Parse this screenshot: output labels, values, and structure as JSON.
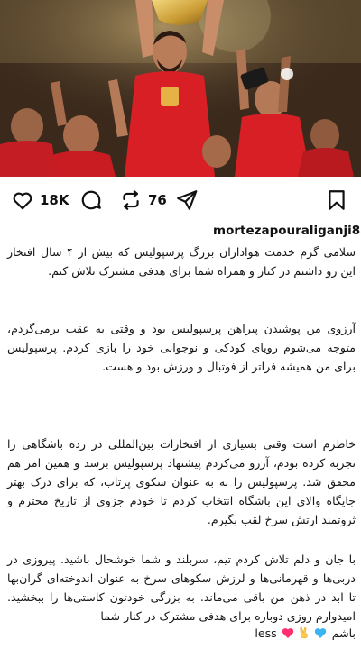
{
  "post": {
    "image": {
      "description_icon": "celebration-photo",
      "colors": {
        "jersey": "#d81f26",
        "trophy": "#d9b24a"
      }
    },
    "actions": {
      "like_icon": "heart-icon",
      "like_count": "18K",
      "comment_icon": "comment-icon",
      "repost_icon": "repost-icon",
      "repost_count": "76",
      "share_icon": "send-icon",
      "save_icon": "bookmark-icon"
    },
    "username": "mortezapouraliganji88 .",
    "caption": {
      "paragraph_1": "سلامی گرم خدمت هواداران بزرگ پرسپولیس که بیش از ۴ سال افتخار این رو داشتم در کنار و همراه شما برای هدفی مشترک تلاش کنم.",
      "paragraph_2": "آرزوی من پوشیدن پیراهن پرسپولیس بود و وقتی به عقب برمی‌گردم، متوجه می‌شوم رویای کودکی و نوجوانی خود را بازی کردم. پرسپولیس برای من همیشه فراتر از فوتبال و ورزش بود و هست.",
      "paragraph_3": "خاطرم است وقتی بسیاری از افتخارات بین‌المللی در رده باشگاهی را تجربه کرده بودم، آرزو می‌کردم پیشنهاد پرسپولیس برسد و همین امر هم محقق شد. پرسپولیس را نه به عنوان سکوی پرتاب، که برای درک بهتر جایگاه والای این باشگاه انتخاب کردم تا خودم جزوی از تاریخ محترم و ثروتمند ارتش سرخ لقب بگیرم.",
      "paragraph_4": "با جان و دلم تلاش کردم تیم، سربلند و شما خوشحال باشید. پیروزی در دربی‌ها و قهرمانی‌ها و لرزش سکوهای سرخ به عنوان اندوخته‌ای گران‌بها تا ابد در ذهن من باقی می‌ماند. به بزرگی خودتون کاستی‌ها را ببخشید. امیدوارم روزی دوباره برای هدفی مشترک در کنار شما",
      "closing_word": "باشم",
      "closing_emojis": [
        "heart-red-icon",
        "victory-hand-icon",
        "heart-blue-icon"
      ],
      "tail": "less"
    }
  }
}
